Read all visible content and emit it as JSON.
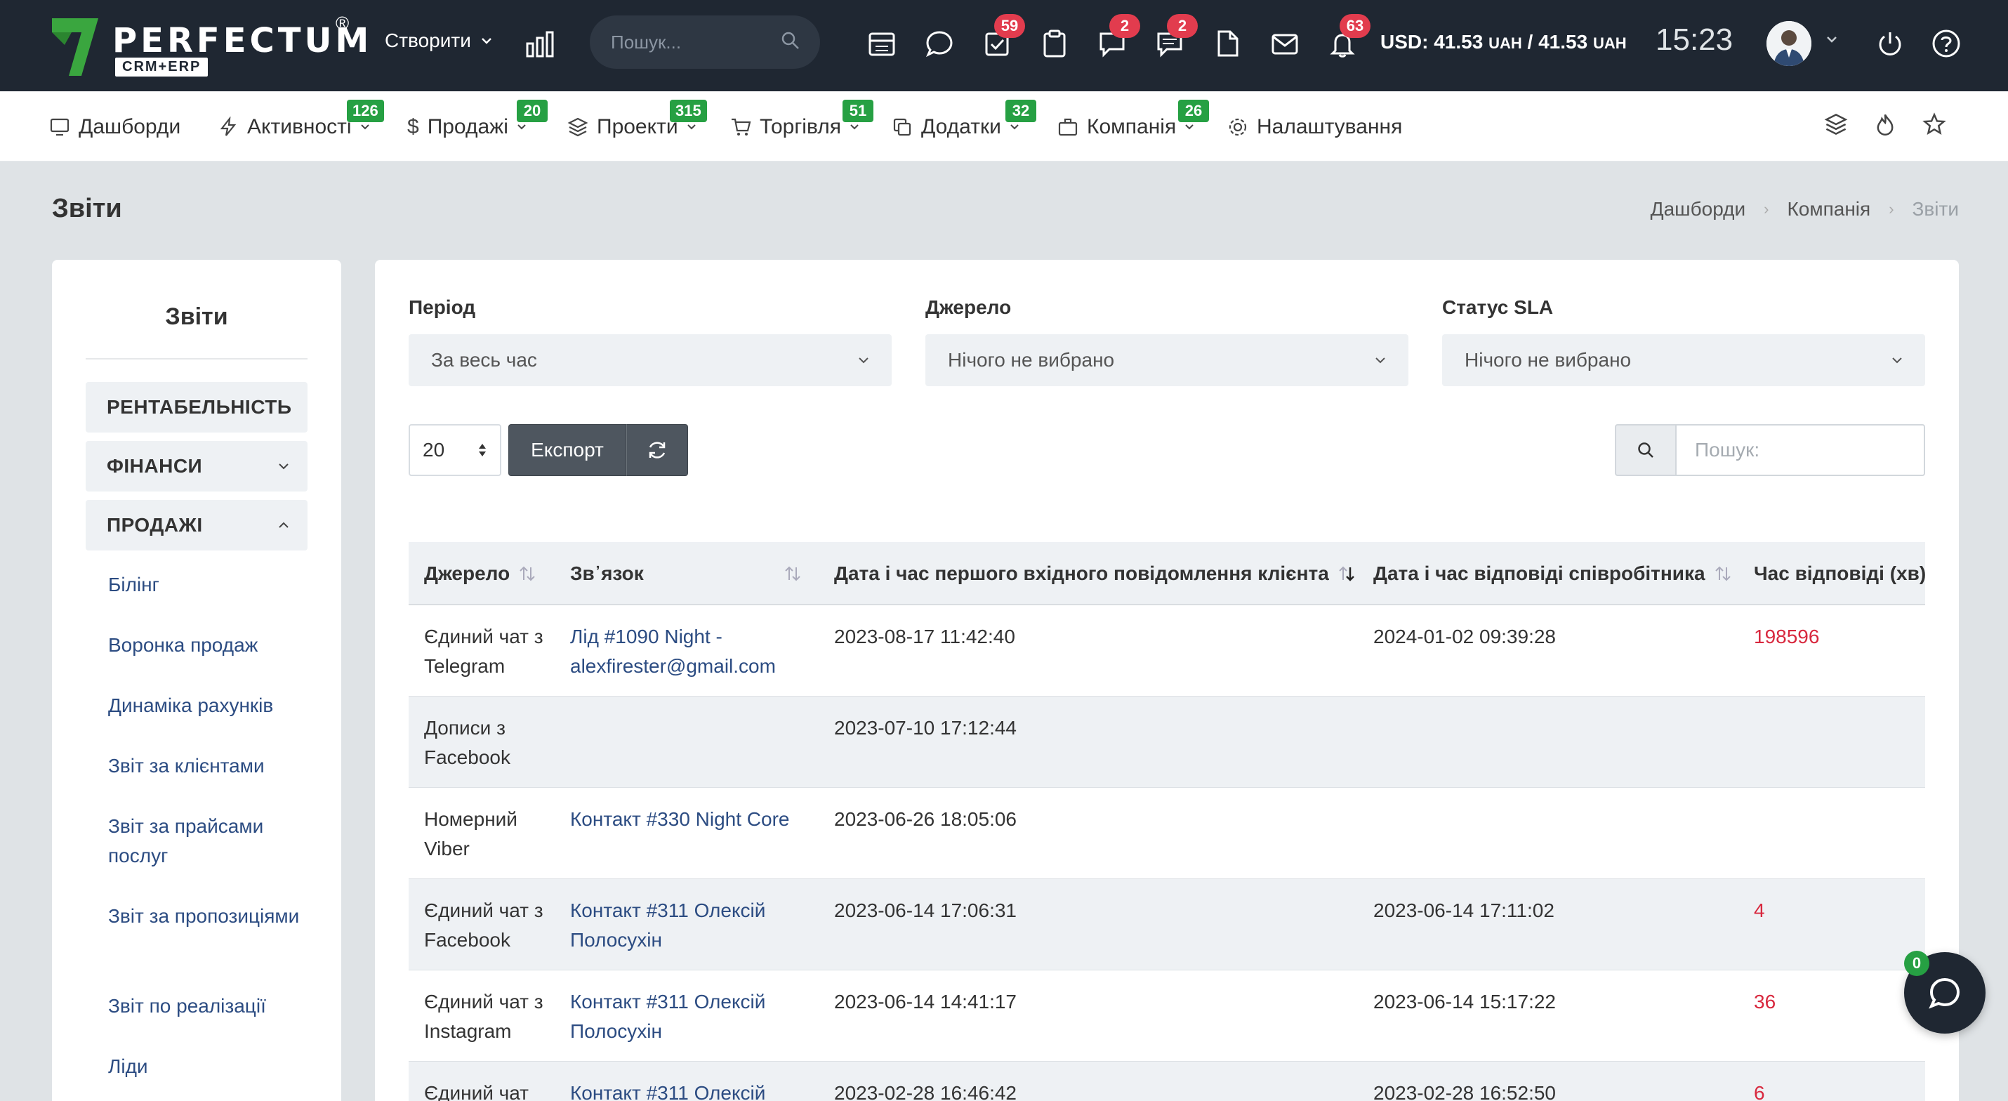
{
  "topbar": {
    "logo_text": "PERFECTUM",
    "logo_reg": "®",
    "logo_sub": "CRM+ERP",
    "create_label": "Створити",
    "search_placeholder": "Пошук...",
    "badges": {
      "tasks": "59",
      "chat": "2",
      "notes": "2",
      "notifications": "63"
    },
    "currency_label": "USD: 41.53",
    "currency_unit1": "UAH",
    "currency_sep": "/ 41.53",
    "currency_unit2": "UAH",
    "time": "15:23"
  },
  "nav": {
    "items": [
      {
        "label": "Дашборди"
      },
      {
        "label": "Активності",
        "badge": "126"
      },
      {
        "label": "Продажі",
        "badge": "20"
      },
      {
        "label": "Проекти",
        "badge": "315"
      },
      {
        "label": "Торгівля",
        "badge": "51"
      },
      {
        "label": "Додатки",
        "badge": "32"
      },
      {
        "label": "Компанія",
        "badge": "26"
      },
      {
        "label": "Налаштування"
      }
    ]
  },
  "page": {
    "title": "Звіти",
    "breadcrumb": [
      "Дашборди",
      "Компанія",
      "Звіти"
    ]
  },
  "sidebar": {
    "title": "Звіти",
    "categories": [
      "РЕНТАБЕЛЬНІСТЬ",
      "ФІНАНСИ",
      "ПРОДАЖІ"
    ],
    "links": [
      "Білінг",
      "Воронка продаж",
      "Динаміка рахунків",
      "Звіт за клієнтами",
      "Звіт за прайсами послуг",
      "Звіт за пропозиціями",
      "Звіт по реалізації",
      "Ліди"
    ]
  },
  "filters": {
    "period_label": "Період",
    "period_value": "За весь час",
    "source_label": "Джерело",
    "source_value": "Нічого не вибрано",
    "sla_label": "Статус SLA",
    "sla_value": "Нічого не вибрано"
  },
  "toolbar": {
    "page_length": "20",
    "export_label": "Експорт",
    "search_placeholder": "Пошук:"
  },
  "table": {
    "columns": [
      "Джерело",
      "Зв᾽язок",
      "Дата і час першого вхідного повідомлення клієнта",
      "Дата і час відповіді співробітника",
      "Час відповіді (хв)"
    ],
    "rows": [
      {
        "source": "Єдиний чат з Telegram",
        "link": "Лід #1090 Night - alexfirester@gmail.com",
        "first_msg": "2023-08-17 11:42:40",
        "reply": "2024-01-02 09:39:28",
        "minutes": "198596"
      },
      {
        "source": "Дописи з Facebook",
        "link": "",
        "first_msg": "2023-07-10 17:12:44",
        "reply": "",
        "minutes": ""
      },
      {
        "source": "Номерний Viber",
        "link": "Контакт #330 Night Core",
        "first_msg": "2023-06-26 18:05:06",
        "reply": "",
        "minutes": ""
      },
      {
        "source": "Єдиний чат з Facebook",
        "link": "Контакт #311 Олексій Полосухін",
        "first_msg": "2023-06-14 17:06:31",
        "reply": "2023-06-14 17:11:02",
        "minutes": "4"
      },
      {
        "source": "Єдиний чат з Instagram",
        "link": "Контакт #311 Олексій Полосухін",
        "first_msg": "2023-06-14 14:41:17",
        "reply": "2023-06-14 15:17:22",
        "minutes": "36"
      },
      {
        "source": "Єдиний чат",
        "link": "Контакт #311 Олексій",
        "first_msg": "2023-02-28 16:46:42",
        "reply": "2023-02-28 16:52:50",
        "minutes": "6"
      }
    ]
  },
  "chat_widget": {
    "badge": "0"
  },
  "colors": {
    "topbar": "#1f2732",
    "badge_red": "#e23c4e",
    "badge_green": "#26a043",
    "link": "#2c4c82",
    "danger": "#d8283e"
  }
}
